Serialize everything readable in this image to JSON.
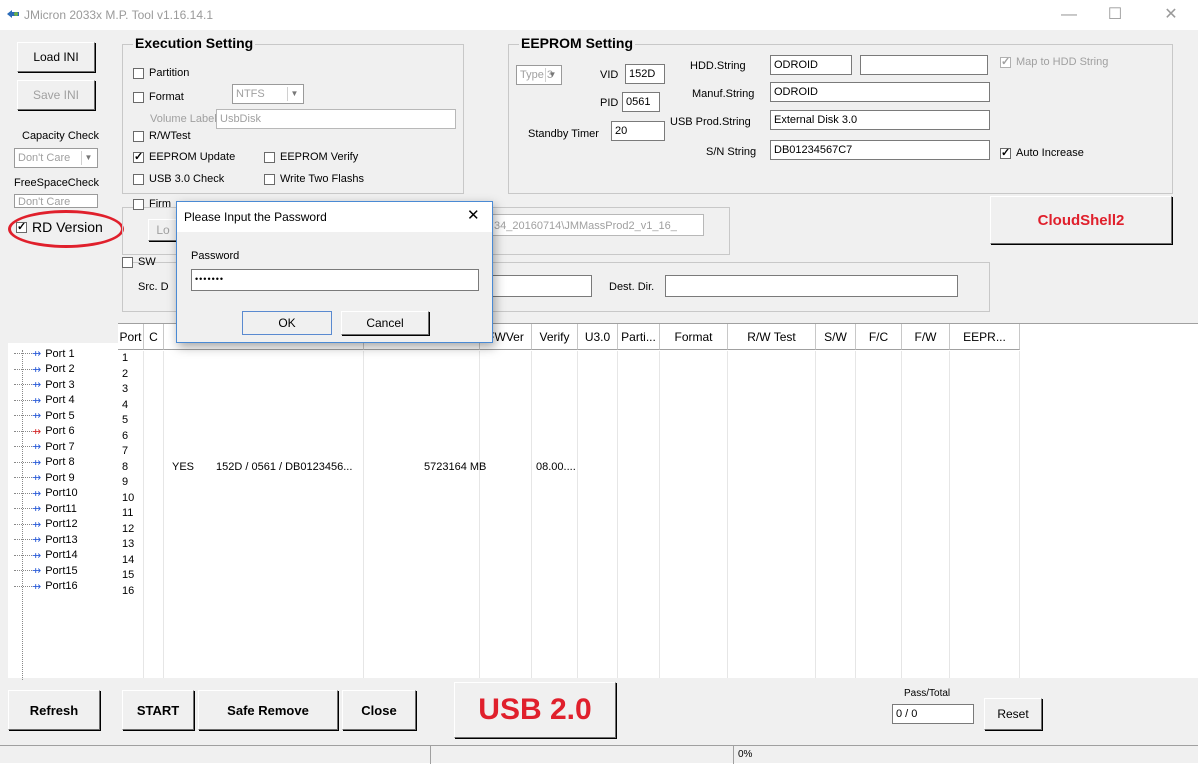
{
  "window": {
    "title": "JMicron 2033x M.P. Tool v1.16.14.1",
    "minimize": "—",
    "maximize": "☐",
    "close": "✕"
  },
  "left": {
    "load_ini": "Load INI",
    "save_ini": "Save INI",
    "capacity_check_label": "Capacity Check",
    "capacity_check_value": "Don't Care",
    "freespace_label": "FreeSpaceCheck",
    "freespace_value": "Don't Care",
    "rd_version": "RD Version"
  },
  "execution": {
    "title": "Execution Setting",
    "partition": "Partition",
    "format": "Format",
    "format_value": "NTFS",
    "volume_label": "Volume Label",
    "volume_value": "UsbDisk",
    "rw_test": "R/WTest",
    "eeprom_update": "EEPROM Update",
    "eeprom_verify": "EEPROM Verify",
    "usb30_check": "USB 3.0 Check",
    "write_two_flashes": "Write Two Flashs",
    "firmware": "Firm",
    "load": "Lo",
    "sw": "SW",
    "src_dir": "Src. D",
    "path_value": "34_20160714\\JMMassProd2_v1_16_",
    "dest_dir": "Dest. Dir."
  },
  "eeprom": {
    "title": "EEPROM Setting",
    "type_value": "Type 3",
    "vid_label": "VID",
    "vid_value": "152D",
    "pid_label": "PID",
    "pid_value": "0561",
    "standby_label": "Standby Timer",
    "standby_value": "20",
    "hdd_label": "HDD.String",
    "hdd_value": "ODROID",
    "map_hdd": "Map to HDD String",
    "manuf_label": "Manuf.String",
    "manuf_value": "ODROID",
    "usbprod_label": "USB Prod.String",
    "usbprod_value": "External Disk 3.0",
    "sn_label": "S/N String",
    "sn_value": "DB01234567C7",
    "auto_increase": "Auto Increase"
  },
  "cloudshell_label": "CloudShell2",
  "table": {
    "headers": [
      "Port",
      "C",
      "",
      "",
      "FWVer",
      "Verify",
      "U3.0",
      "Parti...",
      "Format",
      "R/W Test",
      "S/W",
      "F/C",
      "F/W",
      "EEPR..."
    ],
    "row_numbers": [
      "1",
      "2",
      "3",
      "4",
      "5",
      "6",
      "7",
      "8",
      "9",
      "10",
      "11",
      "12",
      "13",
      "14",
      "15",
      "16"
    ],
    "active_row": {
      "c": "YES",
      "id": "152D / 0561 / DB0123456...",
      "capacity": "5723164 MB",
      "fwver": "08.00...."
    }
  },
  "ports": [
    "Port 1",
    "Port 2",
    "Port 3",
    "Port 4",
    "Port 5",
    "Port 6",
    "Port 7",
    "Port 8",
    "Port 9",
    "Port10",
    "Port11",
    "Port12",
    "Port13",
    "Port14",
    "Port15",
    "Port16"
  ],
  "bottom": {
    "refresh": "Refresh",
    "start": "START",
    "safe_remove": "Safe Remove",
    "close": "Close",
    "usb_mode": "USB 2.0",
    "pass_total_label": "Pass/Total",
    "pass_total_value": "0 / 0",
    "reset": "Reset",
    "progress": "0%"
  },
  "dialog": {
    "title": "Please Input the Password",
    "close": "✕",
    "password_label": "Password",
    "password_value": "•••••••",
    "ok": "OK",
    "cancel": "Cancel"
  },
  "colors": {
    "accent_red": "#e0202c",
    "usb_icon": "#2a5bd7"
  }
}
